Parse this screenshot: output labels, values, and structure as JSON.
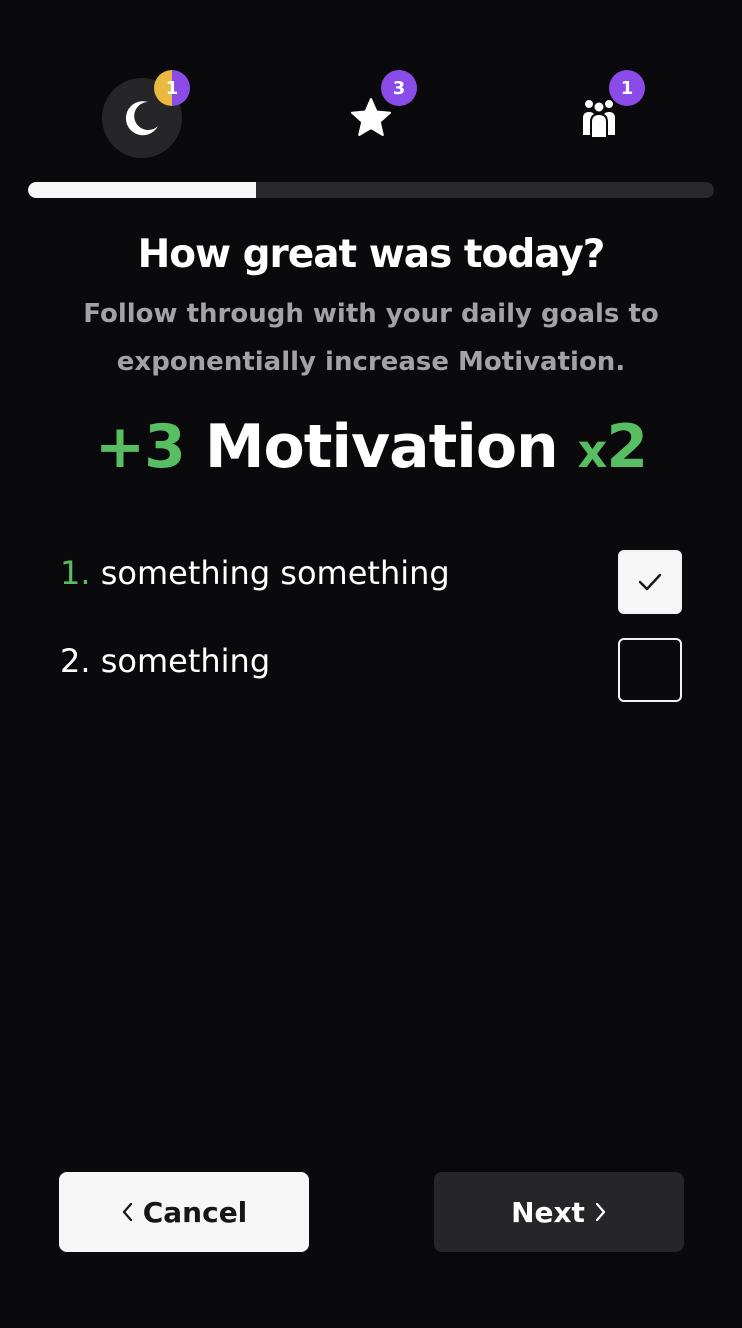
{
  "steps": [
    {
      "icon": "moon-icon",
      "badge": "1",
      "active": true
    },
    {
      "icon": "star-icon",
      "badge": "3",
      "active": false
    },
    {
      "icon": "group-icon",
      "badge": "1",
      "active": false
    }
  ],
  "progress": {
    "fraction": 0.333
  },
  "header": {
    "title": "How great was today?",
    "subtitle": "Follow through with your daily goals to exponentially increase Motivation."
  },
  "motivation": {
    "amount": "+3",
    "label": "Motivation",
    "multiplier_prefix": "x",
    "multiplier_value": "2"
  },
  "goals": [
    {
      "number": "1.",
      "text": "something something",
      "checked": true
    },
    {
      "number": "2.",
      "text": "something",
      "checked": false
    }
  ],
  "buttons": {
    "cancel": "Cancel",
    "next": "Next"
  },
  "colors": {
    "accent_green": "#57bf61",
    "badge_purple": "#8b4be8",
    "badge_gold": "#e9b940",
    "background": "#0a0a0c"
  }
}
